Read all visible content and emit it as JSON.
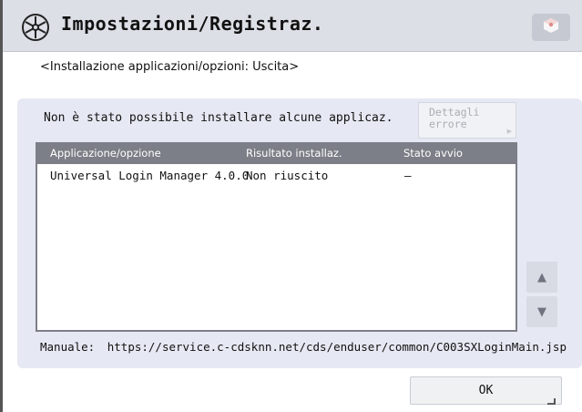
{
  "header": {
    "title": "Impostazioni/Registraz.",
    "icon": "settings-register-icon",
    "right_button_icon": "cube-icon"
  },
  "subtitle": "<Installazione applicazioni/opzioni: Uscita>",
  "message": "Non è stato possibile installare alcune applicaz.",
  "error_details_button": {
    "label": "Dettagli errore"
  },
  "table": {
    "columns": [
      "Applicazione/opzione",
      "Risultato installaz.",
      "Stato avvio"
    ],
    "rows": [
      [
        "Universal Login Manager 4.0.0",
        "Non riuscito",
        "–"
      ]
    ]
  },
  "scroll": {
    "up_icon": "arrow-up-icon",
    "down_icon": "arrow-down-icon"
  },
  "manual": {
    "label": "Manuale:",
    "url": "https://service.c-cdsknn.net/cds/enduser/common/C003SXLoginMain.jsp"
  },
  "ok_button": {
    "label": "OK"
  },
  "colors": {
    "header_bg": "#dcdfe6",
    "panel_bg": "#e6e9f3",
    "table_header_bg": "#7c7f87",
    "accent_button": "#c6c9d1"
  }
}
